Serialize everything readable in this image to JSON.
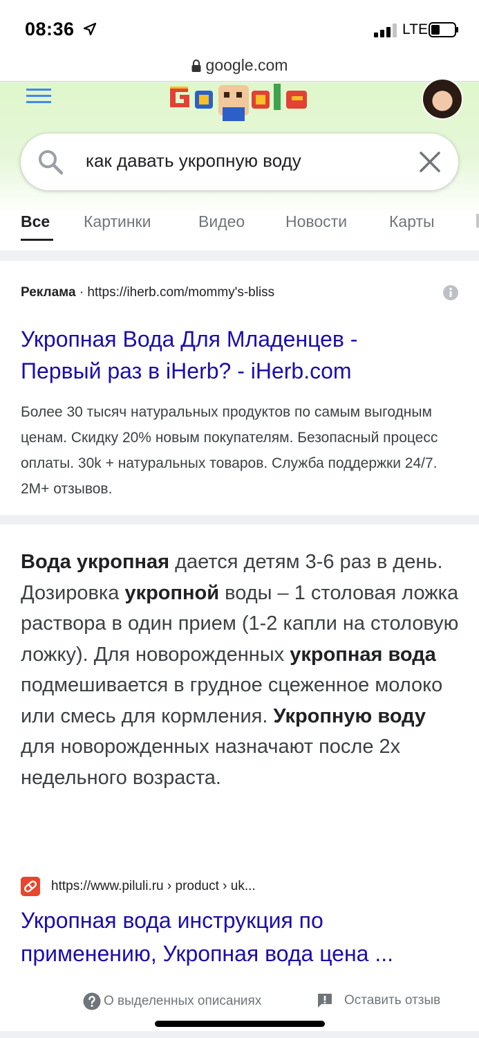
{
  "status_bar": {
    "time": "08:36",
    "network": "LTE"
  },
  "browser": {
    "url": "google.com"
  },
  "search": {
    "query": "как давать укропную воду"
  },
  "tabs": [
    {
      "label": "Все",
      "active": true
    },
    {
      "label": "Картинки",
      "active": false
    },
    {
      "label": "Видео",
      "active": false
    },
    {
      "label": "Новости",
      "active": false
    },
    {
      "label": "Карты",
      "active": false
    }
  ],
  "ad": {
    "label": "Реклама",
    "separator": "·",
    "url": "https://iherb.com/mommy's-bliss",
    "title_line1": "Укропная Вода Для Младенцев -",
    "title_line2": "Первый раз в iHerb? - iHerb.com",
    "description": "Более 30 тысяч натуральных продуктов по самым выгодным ценам. Скидку 20% новым покупателям. Безопасный процесс оплаты. 30k + натуральных товаров. Служба поддержки 24/7. 2M+ отзывов."
  },
  "featured_snippet": {
    "segments": [
      {
        "text": "Вода укропная",
        "bold": true
      },
      {
        "text": " дается детям 3-6 раз в день. Дозировка ",
        "bold": false
      },
      {
        "text": "укропной",
        "bold": true
      },
      {
        "text": " воды – 1 столовая ложка раствора в один прием (1-2 капли на столовую ложку). Для новорожденных ",
        "bold": false
      },
      {
        "text": "укропная вода",
        "bold": true
      },
      {
        "text": " подмешивается в грудное сцеженное молоко или смесь для кормления. ",
        "bold": false
      },
      {
        "text": "Укропную воду",
        "bold": true
      },
      {
        "text": " для новорожденных назначают после 2х недельного возраста.",
        "bold": false
      }
    ],
    "source_url": "https://www.piluli.ru › product › uk...",
    "result_title_line1": "Укропная вода инструкция по",
    "result_title_line2": "применению, Укропная вода цена ...",
    "about_label": "О выделенных описаниях",
    "feedback_label": "Оставить отзыв"
  },
  "colors": {
    "link": "#1a0dab",
    "menu_icon": "#4285f4",
    "favicon": "#e8452c",
    "header_green": "#dff7cb"
  },
  "icons": [
    "location-arrow-icon",
    "signal-icon",
    "battery-icon",
    "lock-icon",
    "menu-icon",
    "search-icon",
    "close-icon",
    "info-icon",
    "help-icon",
    "feedback-icon"
  ]
}
